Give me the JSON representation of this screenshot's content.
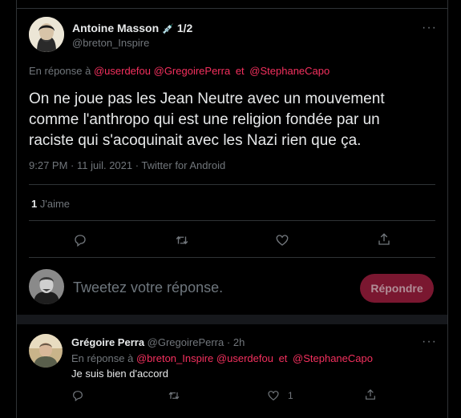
{
  "main_tweet": {
    "author_name": "Antoine Masson",
    "badge": "💉",
    "thread_index": "1/2",
    "handle": "@breton_Inspire",
    "reply_prefix": "En réponse à",
    "mention_1": "@userdefou",
    "mention_2": "@GregoirePerra",
    "conjunction": "et",
    "mention_3": "@StephaneCapo",
    "text_line_1": "On ne joue pas les Jean Neutre avec un mouvement",
    "text_line_2": "comme l'anthropo qui est une religion fondée par un",
    "text_line_3": "raciste qui s'acoquinait avec les Nazi rien que ça.",
    "meta": "9:27 PM · 11 juil. 2021 · Twitter for Android",
    "likes_count": "1",
    "likes_label": "J'aime"
  },
  "composer": {
    "placeholder": "Tweetez votre réponse.",
    "button_label": "Répondre"
  },
  "reply_tweet": {
    "author_name": "Grégoire Perra",
    "handle": "@GregoirePerra",
    "separator": "·",
    "time": "2h",
    "reply_prefix": "En réponse à",
    "mention_1": "@breton_Inspire",
    "mention_2": "@userdefou",
    "conjunction": "et",
    "mention_3": "@StephaneCapo",
    "text": "Je suis bien d'accord",
    "like_count": "1"
  },
  "colors": {
    "background": "#000000",
    "accent": "#f4305e",
    "muted": "#71767b",
    "button_bg": "#7a1730"
  },
  "icons": [
    "more-icon",
    "reply-icon",
    "retweet-icon",
    "like-icon",
    "share-icon"
  ]
}
